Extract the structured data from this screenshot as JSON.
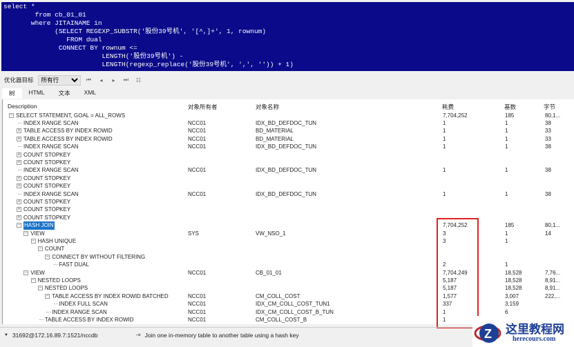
{
  "sql_lines": [
    "select *",
    "        from cb_01_01",
    "       where JITAINAME in",
    "             (SELECT REGEXP_SUBSTR('股份39号机', '[^,]+', 1, rownum)",
    "                FROM dual",
    "              CONNECT BY rownum <=",
    "                         LENGTH('股份39号机') -",
    "                         LENGTH(regexp_replace('股份39号机', ',', '')) + 1)"
  ],
  "toolbar": {
    "label": "优化器目标",
    "select_value": "所有行"
  },
  "tabs": [
    "树",
    "HTML",
    "文本",
    "XML"
  ],
  "columns": [
    "Description",
    "对象所有者",
    "对象名称",
    "耗费",
    "基数",
    "字节"
  ],
  "rows": [
    {
      "l": 0,
      "e": "-",
      "d": "SELECT STATEMENT, GOAL = ALL_ROWS",
      "o": "",
      "n": "",
      "c": "7,704,252",
      "k": "185",
      "b": "80,1..."
    },
    {
      "l": 1,
      "e": "",
      "d": "INDEX RANGE SCAN",
      "o": "NCC01",
      "n": "IDX_BD_DEFDOC_TUN",
      "c": "1",
      "k": "1",
      "b": "38"
    },
    {
      "l": 1,
      "e": "+",
      "d": "TABLE ACCESS BY INDEX ROWID",
      "o": "NCC01",
      "n": "BD_MATERIAL",
      "c": "1",
      "k": "1",
      "b": "33"
    },
    {
      "l": 1,
      "e": "+",
      "d": "TABLE ACCESS BY INDEX ROWID",
      "o": "NCC01",
      "n": "BD_MATERIAL",
      "c": "1",
      "k": "1",
      "b": "33"
    },
    {
      "l": 1,
      "e": "",
      "d": "INDEX RANGE SCAN",
      "o": "NCC01",
      "n": "IDX_BD_DEFDOC_TUN",
      "c": "1",
      "k": "1",
      "b": "38"
    },
    {
      "l": 1,
      "e": "+",
      "d": "COUNT STOPKEY",
      "o": "",
      "n": "",
      "c": "",
      "k": "",
      "b": ""
    },
    {
      "l": 1,
      "e": "+",
      "d": "COUNT STOPKEY",
      "o": "",
      "n": "",
      "c": "",
      "k": "",
      "b": ""
    },
    {
      "l": 1,
      "e": "",
      "d": "INDEX RANGE SCAN",
      "o": "NCC01",
      "n": "IDX_BD_DEFDOC_TUN",
      "c": "1",
      "k": "1",
      "b": "38"
    },
    {
      "l": 1,
      "e": "+",
      "d": "COUNT STOPKEY",
      "o": "",
      "n": "",
      "c": "",
      "k": "",
      "b": ""
    },
    {
      "l": 1,
      "e": "+",
      "d": "COUNT STOPKEY",
      "o": "",
      "n": "",
      "c": "",
      "k": "",
      "b": ""
    },
    {
      "l": 1,
      "e": "",
      "d": "INDEX RANGE SCAN",
      "o": "NCC01",
      "n": "IDX_BD_DEFDOC_TUN",
      "c": "1",
      "k": "1",
      "b": "38"
    },
    {
      "l": 1,
      "e": "+",
      "d": "COUNT STOPKEY",
      "o": "",
      "n": "",
      "c": "",
      "k": "",
      "b": ""
    },
    {
      "l": 1,
      "e": "+",
      "d": "COUNT STOPKEY",
      "o": "",
      "n": "",
      "c": "",
      "k": "",
      "b": ""
    },
    {
      "l": 1,
      "e": "+",
      "d": "COUNT STOPKEY",
      "o": "",
      "n": "",
      "c": "",
      "k": "",
      "b": ""
    },
    {
      "l": 1,
      "e": "-",
      "d": "HASH JOIN",
      "o": "",
      "n": "",
      "c": "7,704,252",
      "k": "185",
      "b": "80,1...",
      "sel": true
    },
    {
      "l": 2,
      "e": "-",
      "d": "VIEW",
      "o": "SYS",
      "n": "VW_NSO_1",
      "c": "3",
      "k": "1",
      "b": "14"
    },
    {
      "l": 3,
      "e": "-",
      "d": "HASH UNIQUE",
      "o": "",
      "n": "",
      "c": "3",
      "k": "1",
      "b": ""
    },
    {
      "l": 4,
      "e": "-",
      "d": "COUNT",
      "o": "",
      "n": "",
      "c": "",
      "k": "",
      "b": ""
    },
    {
      "l": 5,
      "e": "-",
      "d": "CONNECT BY WITHOUT FILTERING",
      "o": "",
      "n": "",
      "c": "",
      "k": "",
      "b": ""
    },
    {
      "l": 6,
      "e": "",
      "d": "FAST DUAL",
      "o": "",
      "n": "",
      "c": "2",
      "k": "1",
      "b": ""
    },
    {
      "l": 2,
      "e": "-",
      "d": "VIEW",
      "o": "NCC01",
      "n": "CB_01_01",
      "c": "7,704,249",
      "k": "18,528",
      "b": "7,76..."
    },
    {
      "l": 3,
      "e": "-",
      "d": "NESTED LOOPS",
      "o": "",
      "n": "",
      "c": "5,187",
      "k": "18,528",
      "b": "8,91..."
    },
    {
      "l": 4,
      "e": "-",
      "d": "NESTED LOOPS",
      "o": "",
      "n": "",
      "c": "5,187",
      "k": "18,528",
      "b": "8,91..."
    },
    {
      "l": 5,
      "e": "-",
      "d": "TABLE ACCESS BY INDEX ROWID BATCHED",
      "o": "NCC01",
      "n": "CM_COLL_COST",
      "c": "1,577",
      "k": "3,007",
      "b": "222,..."
    },
    {
      "l": 6,
      "e": "",
      "d": "INDEX FULL SCAN",
      "o": "NCC01",
      "n": "IDX_CM_COLL_COST_TUN1",
      "c": "337",
      "k": "3,159",
      "b": ""
    },
    {
      "l": 5,
      "e": "",
      "d": "INDEX RANGE SCAN",
      "o": "NCC01",
      "n": "IDX_CM_COLL_COST_B_TUN",
      "c": "1",
      "k": "6",
      "b": ""
    },
    {
      "l": 4,
      "e": "",
      "d": "TABLE ACCESS BY INDEX ROWID",
      "o": "NCC01",
      "n": "CM_COLL_COST_B",
      "c": "1",
      "k": "",
      "b": ""
    }
  ],
  "status": {
    "connection": "31692@172.16.89.7:1521/nccdb",
    "hint": "Join one in-memory table to another table using a hash key"
  },
  "watermark": {
    "title": "这里教程网",
    "url": "herecours.com"
  },
  "colors": {
    "sql_bg": "#0a0a8a",
    "selection": "#1a73c9",
    "highlight_box": "#e02020"
  }
}
